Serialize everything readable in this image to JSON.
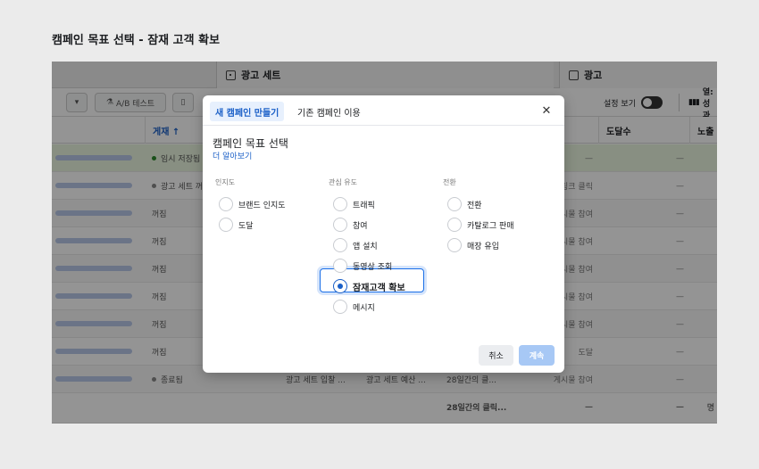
{
  "page_title": "캠페인 목표 선택 - 잠재 고객 확보",
  "manager": {
    "sections": {
      "adset": "광고 세트",
      "ad": "광고"
    },
    "toolbar": {
      "ab_test": "A/B 테스트",
      "view_settings": "설정 보기",
      "columns": "열: 성과"
    },
    "headers": {
      "post": "게재 ↑",
      "d1": "",
      "reach": "도달수",
      "impressions": "노출"
    },
    "rows": [
      {
        "post": "임시 저장됨",
        "dot": "#2e8b2e",
        "adset": "",
        "budget": "",
        "result": "",
        "m1": "—",
        "m2": "—",
        "m3": ""
      },
      {
        "post": "광고 세트 꺼짐",
        "dot": "#888888",
        "adset": "",
        "budget": "",
        "result": "",
        "m1": "링크 클릭",
        "m2": "—",
        "m3": ""
      },
      {
        "post": "꺼짐",
        "dot": "",
        "adset": "",
        "budget": "",
        "result": "",
        "m1": "게시물 참여",
        "m2": "—",
        "m3": ""
      },
      {
        "post": "꺼짐",
        "dot": "",
        "adset": "",
        "budget": "",
        "result": "",
        "m1": "게시물 참여",
        "m2": "—",
        "m3": ""
      },
      {
        "post": "꺼짐",
        "dot": "",
        "adset": "",
        "budget": "",
        "result": "",
        "m1": "게시물 참여",
        "m2": "—",
        "m3": ""
      },
      {
        "post": "꺼짐",
        "dot": "",
        "adset": "",
        "budget": "",
        "result": "",
        "m1": "게시물 참여",
        "m2": "—",
        "m3": ""
      },
      {
        "post": "꺼짐",
        "dot": "",
        "adset": "",
        "budget": "",
        "result": "",
        "m1": "게시물 참여",
        "m2": "—",
        "m3": ""
      },
      {
        "post": "꺼짐",
        "dot": "",
        "adset": "",
        "budget": "",
        "result": "",
        "m1": "도달",
        "m2": "—",
        "m3": ""
      },
      {
        "post": "종료됨",
        "dot": "#888888",
        "adset": "광고 세트 입찰 ...",
        "budget": "광고 세트 예산 ...",
        "result": "28일간의 클...",
        "m1": "게시물 참여",
        "m2": "—",
        "m3": ""
      },
      {
        "post": "",
        "dot": "",
        "adset": "",
        "budget": "",
        "result": "28일간의 클릭...",
        "m1": "—",
        "m2": "—",
        "m3": "명"
      }
    ]
  },
  "modal": {
    "tabs": {
      "new": "새 캠페인 만들기",
      "existing": "기존 캠페인 이용"
    },
    "close": "✕",
    "title": "캠페인 목표 선택",
    "learn_more": "더 알아보기",
    "columns": {
      "awareness": {
        "label": "인지도",
        "options": [
          "브랜드 인지도",
          "도달"
        ]
      },
      "consideration": {
        "label": "관심 유도",
        "options": [
          "트래픽",
          "참여",
          "앱 설치",
          "동영상 조회",
          "잠재고객 확보",
          "메시지"
        ]
      },
      "conversion": {
        "label": "전환",
        "options": [
          "전환",
          "카탈로그 판매",
          "매장 유입"
        ]
      }
    },
    "selected": "잠재고객 확보",
    "cancel": "취소",
    "continue": "계속"
  },
  "colors": {
    "accent": "#1a5fc7",
    "selected_border": "#1a6fe8",
    "continue_disabled": "#a7c8f5"
  }
}
